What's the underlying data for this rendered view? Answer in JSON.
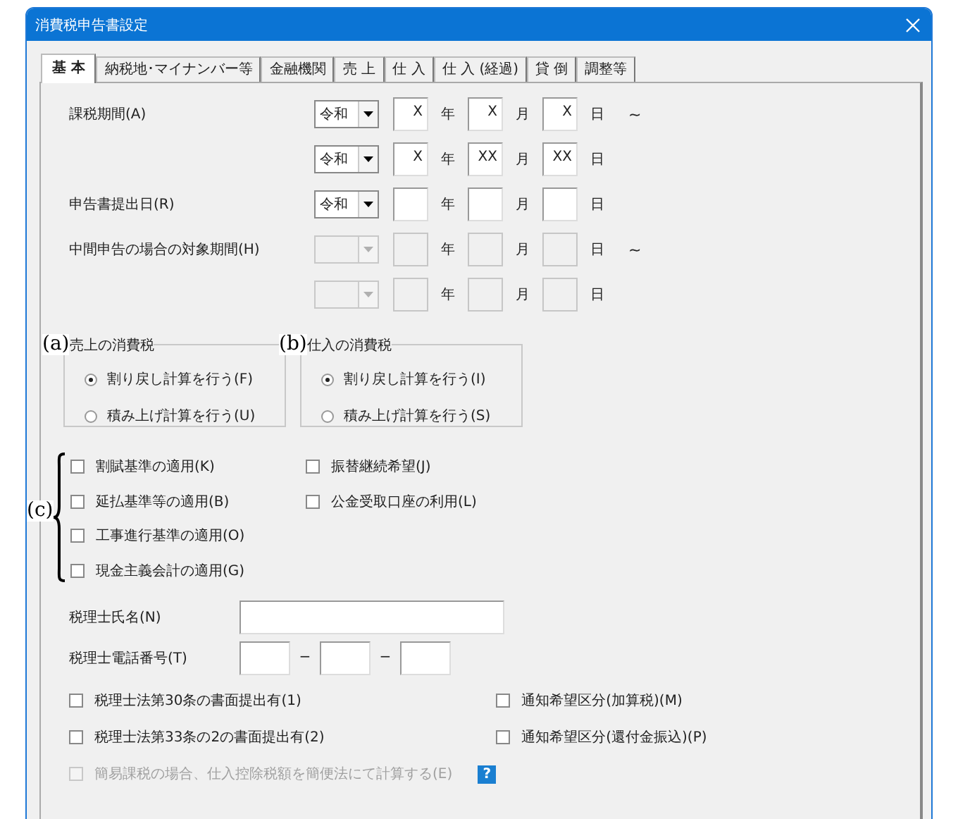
{
  "window": {
    "title": "消費税申告書設定"
  },
  "tabs": [
    {
      "label": "基 本",
      "selected": true
    },
    {
      "label": "納税地･マイナンバー等",
      "selected": false
    },
    {
      "label": "金融機関",
      "selected": false
    },
    {
      "label": "売 上",
      "selected": false
    },
    {
      "label": "仕 入",
      "selected": false
    },
    {
      "label": "仕 入 (経過)",
      "selected": false
    },
    {
      "label": "貸 倒",
      "selected": false
    },
    {
      "label": "調整等",
      "selected": false
    }
  ],
  "date_rows": [
    {
      "label": "課税期間(A)",
      "era": "令和",
      "year": "X",
      "year_unit": "年",
      "month": "X",
      "month_unit": "月",
      "day": "X",
      "day_unit": "日",
      "suffix": "~",
      "disabled": false
    },
    {
      "era": "令和",
      "year": "X",
      "year_unit": "年",
      "month": "XX",
      "month_unit": "月",
      "day": "XX",
      "day_unit": "日",
      "disabled": false
    },
    {
      "label": "申告書提出日(R)",
      "era": "令和",
      "year_unit": "年",
      "month_unit": "月",
      "day_unit": "日",
      "disabled": false
    },
    {
      "label": "中間申告の場合の対象期間(H)",
      "year_unit": "年",
      "month_unit": "月",
      "day_unit": "日",
      "suffix": "~",
      "disabled": true
    },
    {
      "year_unit": "年",
      "month_unit": "月",
      "day_unit": "日",
      "disabled": true
    }
  ],
  "groups": [
    {
      "annotation": "(a)",
      "title": "売上の消費税",
      "options": [
        {
          "label": "割り戻し計算を行う(F)",
          "selected": true
        },
        {
          "label": "積み上げ計算を行う(U)",
          "selected": false
        }
      ]
    },
    {
      "annotation": "(b)",
      "title": "仕入の消費税",
      "options": [
        {
          "label": "割り戻し計算を行う(I)",
          "selected": true
        },
        {
          "label": "積み上げ計算を行う(S)",
          "selected": false
        }
      ]
    }
  ],
  "annotation_c": "(c)",
  "checks_left": [
    {
      "label": "割賦基準の適用(K)",
      "checked": false
    },
    {
      "label": "延払基準等の適用(B)",
      "checked": false
    },
    {
      "label": "工事進行基準の適用(O)",
      "checked": false
    },
    {
      "label": "現金主義会計の適用(G)",
      "checked": false
    }
  ],
  "checks_right": [
    {
      "label": "振替継続希望(J)",
      "checked": false
    },
    {
      "label": "公金受取口座の利用(L)",
      "checked": false
    }
  ],
  "accountant_name": {
    "label": "税理士氏名(N)"
  },
  "accountant_phone": {
    "label": "税理士電話番号(T)",
    "separators": [
      "−",
      "−"
    ]
  },
  "bottom_checks_left": [
    {
      "label": "税理士法第30条の書面提出有(1)",
      "checked": false,
      "disabled": false
    },
    {
      "label": "税理士法第33条の2の書面提出有(2)",
      "checked": false,
      "disabled": false
    },
    {
      "label": "簡易課税の場合、仕入控除税額を簡便法にて計算する(E)",
      "checked": false,
      "disabled": true
    }
  ],
  "bottom_checks_right": [
    {
      "label": "通知希望区分(加算税)(M)",
      "checked": false,
      "disabled": false
    },
    {
      "label": "通知希望区分(還付金振込)(P)",
      "checked": false,
      "disabled": false
    }
  ],
  "help": "?"
}
